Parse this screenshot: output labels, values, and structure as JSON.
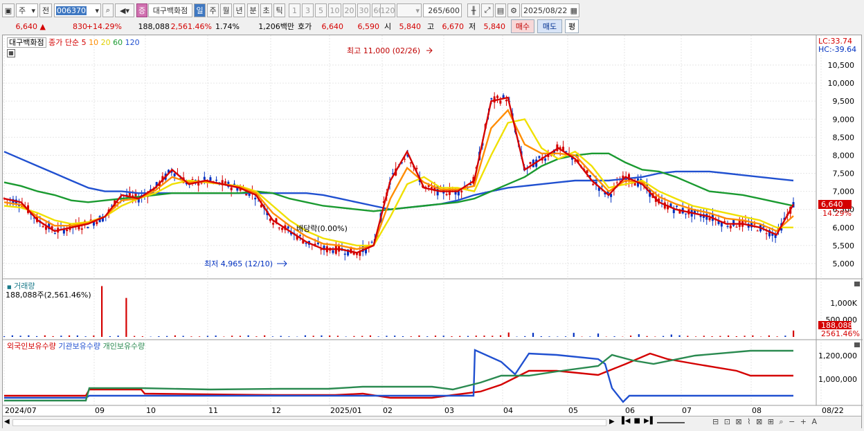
{
  "toolbar": {
    "market": "주",
    "prev": "전",
    "code": "006370",
    "name": "대구백화점",
    "flag": "증",
    "periods": [
      "일",
      "주",
      "월",
      "년",
      "분",
      "초",
      "틱"
    ],
    "active_period": "일",
    "intervals": [
      "1",
      "3",
      "5",
      "10",
      "20",
      "30",
      "60",
      "120"
    ],
    "count": "265",
    "count_max": "/600",
    "date": "2025/08/22"
  },
  "quote": {
    "price": "6,640",
    "arrow": "▲",
    "change": "830",
    "change_pct": "+14.29%",
    "volume": "188,088",
    "vol_ratio": "2,561.46%",
    "turnover": "1.74%",
    "amount": "1,206백만",
    "hoga_label": "호가",
    "ask": "6,640",
    "bid": "6,590",
    "open_label": "시",
    "open": "5,840",
    "high_label": "고",
    "high": "6,670",
    "low_label": "저",
    "low": "5,840",
    "buy": "매수",
    "sell": "매도",
    "eval": "평"
  },
  "price_panel": {
    "name": "대구백화점",
    "ma_title": "종가 단순",
    "ma_periods": [
      "5",
      "10",
      "20",
      "60",
      "120"
    ],
    "ma_colors": [
      "#d40000",
      "#ff8c00",
      "#f0e000",
      "#1a9a30",
      "#2050d0"
    ],
    "lc": "LC:33.74",
    "hc": "HC:-39.64",
    "high_note": "최고 11,000 (02/26)",
    "low_note": "최저 4,965 (12/10)",
    "div_note": "배당락(0.00%)",
    "cur_price": "6,640",
    "cur_pct": "14.29%"
  },
  "volume_panel": {
    "title": "거래량",
    "info": "188,088주(2,561.46%)",
    "cur_vol": "188,088",
    "cur_pct": "2561.46%"
  },
  "holder_panel": {
    "series": [
      "외국인보유수량",
      "기관보유수량",
      "개인보유수량"
    ],
    "colors": [
      "#d40000",
      "#2050d0",
      "#2a8a50"
    ]
  },
  "x_labels": [
    "2024/07",
    "09",
    "10",
    "11",
    "12",
    "2025/01",
    "02",
    "03",
    "04",
    "05",
    "06",
    "07",
    "08",
    "08/22"
  ],
  "chart_data": {
    "type": "line",
    "price_axis": [
      "10,500",
      "10,000",
      "9,500",
      "9,000",
      "8,500",
      "8,000",
      "7,500",
      "7,000",
      "6,500",
      "6,000",
      "5,500",
      "5,000"
    ],
    "volume_axis": [
      "1,000K",
      "500,000"
    ],
    "holder_axis": [
      "1,200,000",
      "1,000,000"
    ],
    "ma5": [
      6800,
      6700,
      6200,
      5900,
      6000,
      6100,
      6300,
      6900,
      6800,
      7100,
      7600,
      7200,
      7300,
      7200,
      7100,
      6900,
      6200,
      5900,
      5600,
      5400,
      5400,
      5300,
      5500,
      7300,
      8100,
      7100,
      7000,
      7000,
      7300,
      9500,
      9600,
      7600,
      7900,
      8200,
      7900,
      7300,
      6900,
      7400,
      7200,
      6700,
      6500,
      6400,
      6300,
      6100,
      6100,
      6000,
      5800,
      6640
    ],
    "ma20": [
      6600,
      6550,
      6400,
      6200,
      6100,
      6150,
      6300,
      6600,
      6800,
      6950,
      7200,
      7300,
      7250,
      7200,
      7150,
      7000,
      6600,
      6200,
      5900,
      5700,
      5600,
      5500,
      5500,
      6300,
      7200,
      7400,
      7100,
      7100,
      7000,
      8000,
      8900,
      9000,
      8200,
      7900,
      8100,
      7700,
      7100,
      7200,
      7300,
      7000,
      6800,
      6600,
      6500,
      6400,
      6300,
      6200,
      6000,
      6000
    ],
    "ma60": [
      7250,
      7150,
      7000,
      6900,
      6750,
      6700,
      6750,
      6800,
      6850,
      6900,
      6950,
      6950,
      6950,
      6950,
      6950,
      7000,
      6950,
      6800,
      6700,
      6600,
      6550,
      6500,
      6450,
      6500,
      6550,
      6600,
      6650,
      6700,
      6800,
      7000,
      7200,
      7400,
      7700,
      7900,
      8000,
      8050,
      8050,
      7800,
      7600,
      7550,
      7400,
      7200,
      7000,
      6950,
      6900,
      6800,
      6700,
      6600
    ],
    "ma120": [
      8100,
      7900,
      7700,
      7500,
      7300,
      7100,
      7000,
      7000,
      6950,
      6950,
      6950,
      6950,
      6950,
      6950,
      6950,
      6950,
      6950,
      6950,
      6950,
      6900,
      6800,
      6700,
      6600,
      6500,
      6550,
      6600,
      6650,
      6750,
      6900,
      7000,
      7100,
      7150,
      7200,
      7250,
      7300,
      7300,
      7300,
      7350,
      7400,
      7500,
      7550,
      7550,
      7550,
      7500,
      7450,
      7400,
      7350,
      7300
    ],
    "volume_spikes": [
      [
        12,
        1500000
      ],
      [
        15,
        1150000
      ],
      [
        62,
        130000
      ],
      [
        65,
        120000
      ],
      [
        70,
        120000
      ],
      [
        73,
        100000
      ],
      [
        78,
        80000
      ],
      [
        82,
        70000
      ],
      [
        97,
        188088
      ]
    ]
  }
}
